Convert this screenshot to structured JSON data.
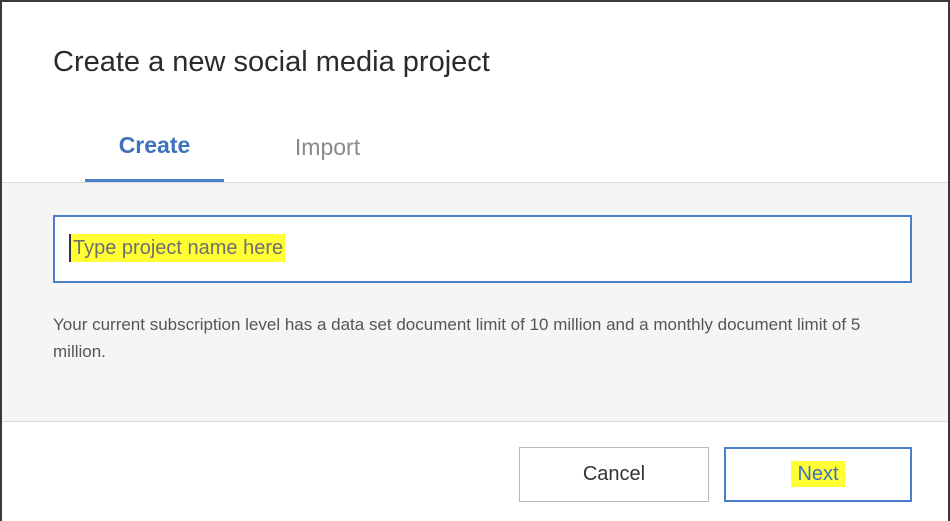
{
  "dialog": {
    "title": "Create a new social media project"
  },
  "tabs": [
    {
      "label": "Create",
      "active": true
    },
    {
      "label": "Import",
      "active": false
    }
  ],
  "project_name": {
    "value": "",
    "placeholder": "Type project name here"
  },
  "info": {
    "text": "Your current subscription level has a data set document limit of 10 million and a monthly document limit of 5 million."
  },
  "footer": {
    "cancel_label": "Cancel",
    "next_label": "Next"
  },
  "colors": {
    "accent": "#4a7fcc",
    "highlight": "#ffff33",
    "body_bg": "#f5f5f5"
  }
}
